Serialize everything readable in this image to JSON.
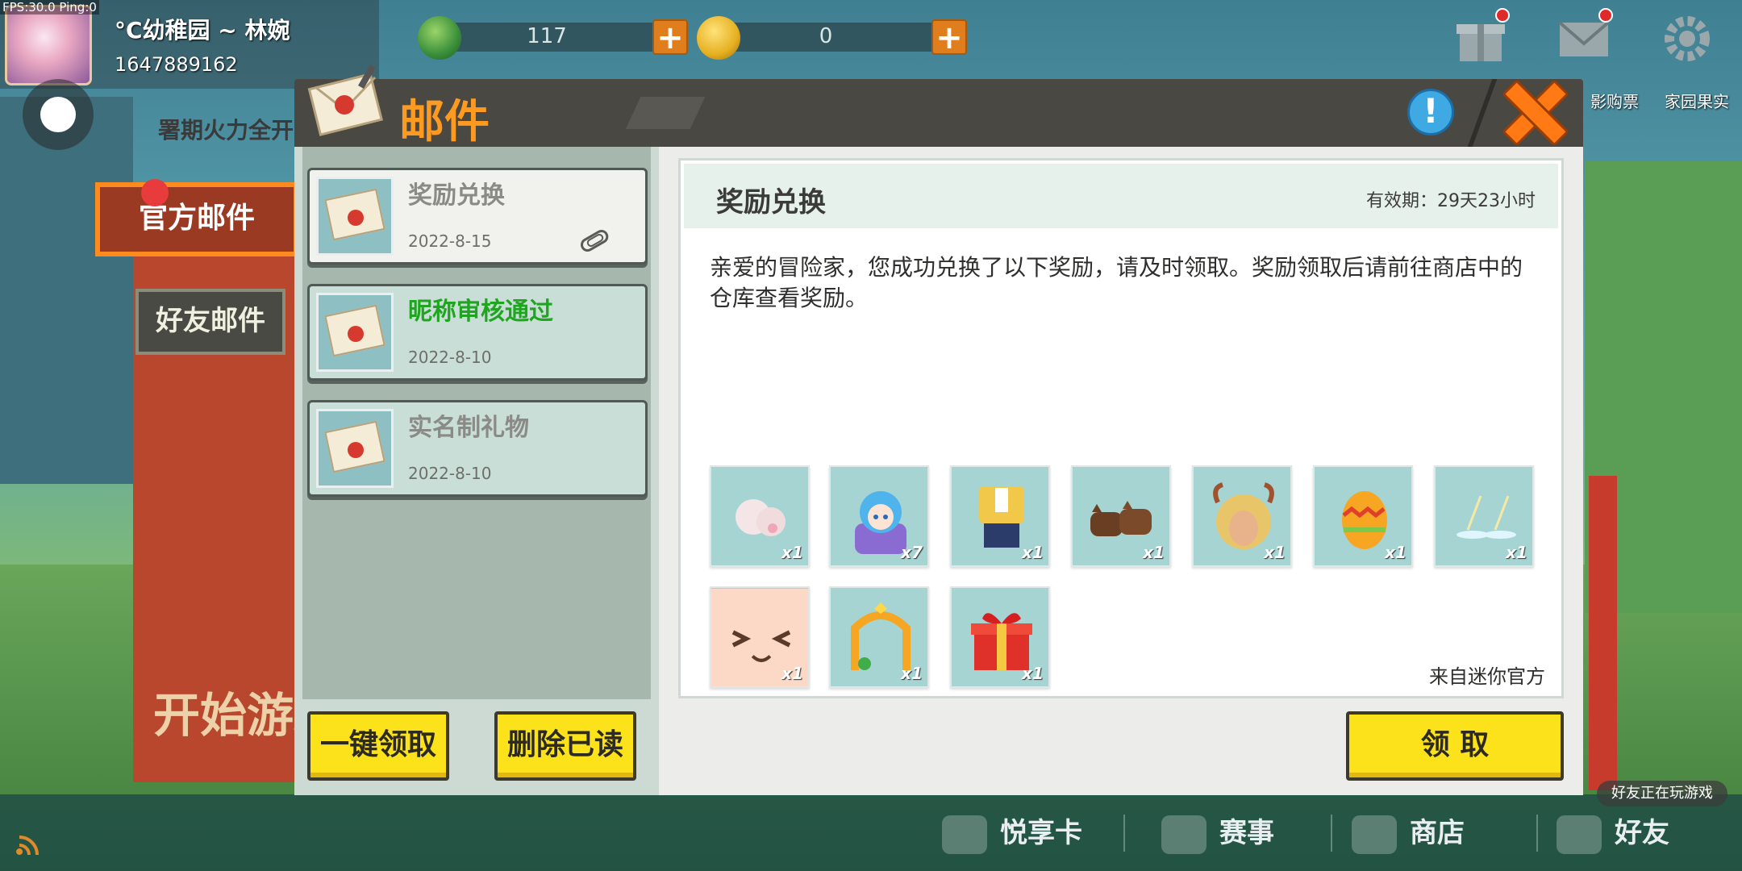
{
  "debug": {
    "fps_text": "FPS:30.0  Ping:0"
  },
  "player": {
    "name": "°C幼稚园 ~ 林婉",
    "id": "1647889162"
  },
  "currency": [
    {
      "name": "green-gem",
      "value": "117",
      "color": "#3a8f3a"
    },
    {
      "name": "gold-coin",
      "value": "0",
      "color": "#e6b020"
    }
  ],
  "scene": {
    "summer_banner": "署期火力全开",
    "start_text": "开始游戏"
  },
  "side_tabs": {
    "official": "官方邮件",
    "friend": "好友邮件"
  },
  "shortcuts": {
    "movie": "影购票",
    "garden": "家园果实"
  },
  "dialog": {
    "title": "邮件",
    "mail_list": [
      {
        "subject": "奖励兑换",
        "date": "2022-8-15",
        "state": "selected",
        "has_attachment": true
      },
      {
        "subject": "昵称审核通过",
        "date": "2022-8-10",
        "state": "unread",
        "has_attachment": false
      },
      {
        "subject": "实名制礼物",
        "date": "2022-8-10",
        "state": "normal",
        "has_attachment": false
      }
    ],
    "buttons": {
      "claim_all": "一键领取",
      "delete_read": "删除已读",
      "claim": "领  取"
    },
    "detail": {
      "title": "奖励兑换",
      "expiry": "有效期：29天23小时",
      "body": "亲爱的冒险家，您成功兑换了以下奖励，请及时领取。奖励领取后请前往商店中的仓库查看奖励。",
      "from": "来自迷你官方",
      "rewards": [
        {
          "icon": "cloud-puff-icon",
          "qty": "x1"
        },
        {
          "icon": "blue-hair-character-icon",
          "qty": "x7"
        },
        {
          "icon": "outfit-suit-icon",
          "qty": "x1"
        },
        {
          "icon": "brown-cats-icon",
          "qty": "x1"
        },
        {
          "icon": "horned-hat-icon",
          "qty": "x1"
        },
        {
          "icon": "easter-egg-icon",
          "qty": "x1"
        },
        {
          "icon": "sparkle-effect-icon",
          "qty": "x1"
        },
        {
          "icon": "face-expression-icon",
          "qty": "x1"
        },
        {
          "icon": "avatar-frame-icon",
          "qty": "x1"
        },
        {
          "icon": "gift-box-icon",
          "qty": "x1"
        }
      ]
    }
  },
  "bottom_nav": [
    {
      "label": "悦享卡",
      "icon": "pig-card-icon"
    },
    {
      "label": "赛事",
      "icon": "trophy-icon"
    },
    {
      "label": "商店",
      "icon": "cart-icon"
    },
    {
      "label": "好友",
      "icon": "friend-icon"
    }
  ],
  "friend_playing": "好友正在玩游戏",
  "colors": {
    "accent_orange": "#ff9a20",
    "button_yellow": "#fbe21b",
    "unread_green": "#1fa51f"
  }
}
